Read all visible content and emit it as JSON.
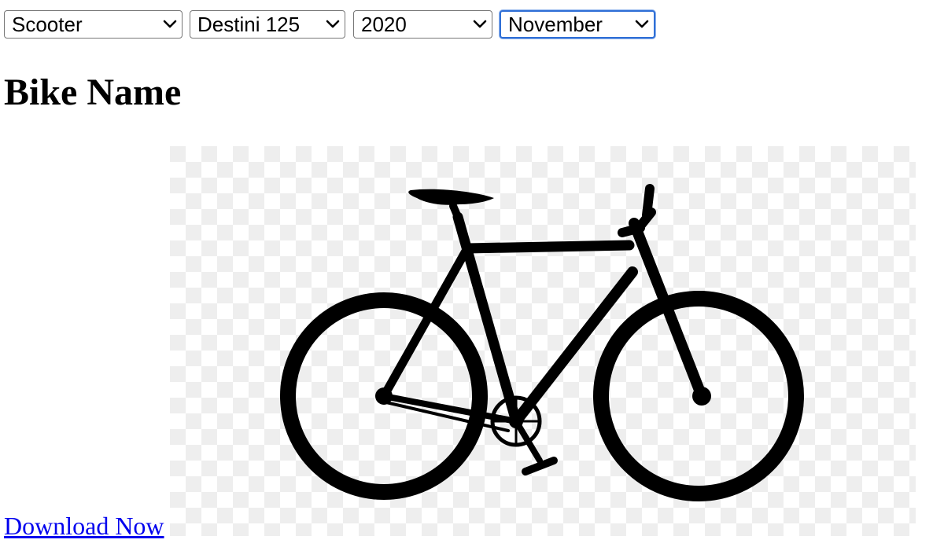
{
  "filters": {
    "vehicle_type": "Scooter",
    "model": "Destini 125",
    "year": "2020",
    "month": "November"
  },
  "heading": "Bike Name",
  "download_link": "Download Now",
  "image": {
    "subject": "bicycle-silhouette",
    "background": "transparent-checkerboard"
  }
}
